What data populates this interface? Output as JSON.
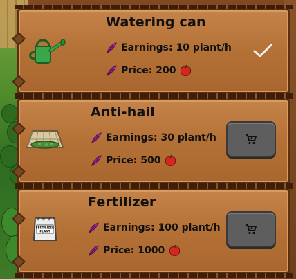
{
  "colors": {
    "accent_feather": "#9b2aa0",
    "button_bg": "#5e5e5e",
    "wood": "#b47136",
    "apple": "#d7261e"
  },
  "items": [
    {
      "title": "Watering can",
      "earnings": "Earnings: 10 plant/h",
      "price": "Price: 200",
      "icon": "watering-can-icon",
      "state": "owned"
    },
    {
      "title": "Anti-hail",
      "earnings": "Earnings: 30 plant/h",
      "price": "Price: 500",
      "icon": "anti-hail-net-icon",
      "state": "buy"
    },
    {
      "title": "Fertilizer",
      "earnings": "Earnings: 100 plant/h",
      "price": "Price: 1000",
      "icon": "fertilizer-bag-icon",
      "bag_label": "FERTILIZER PLANT",
      "state": "buy"
    }
  ]
}
